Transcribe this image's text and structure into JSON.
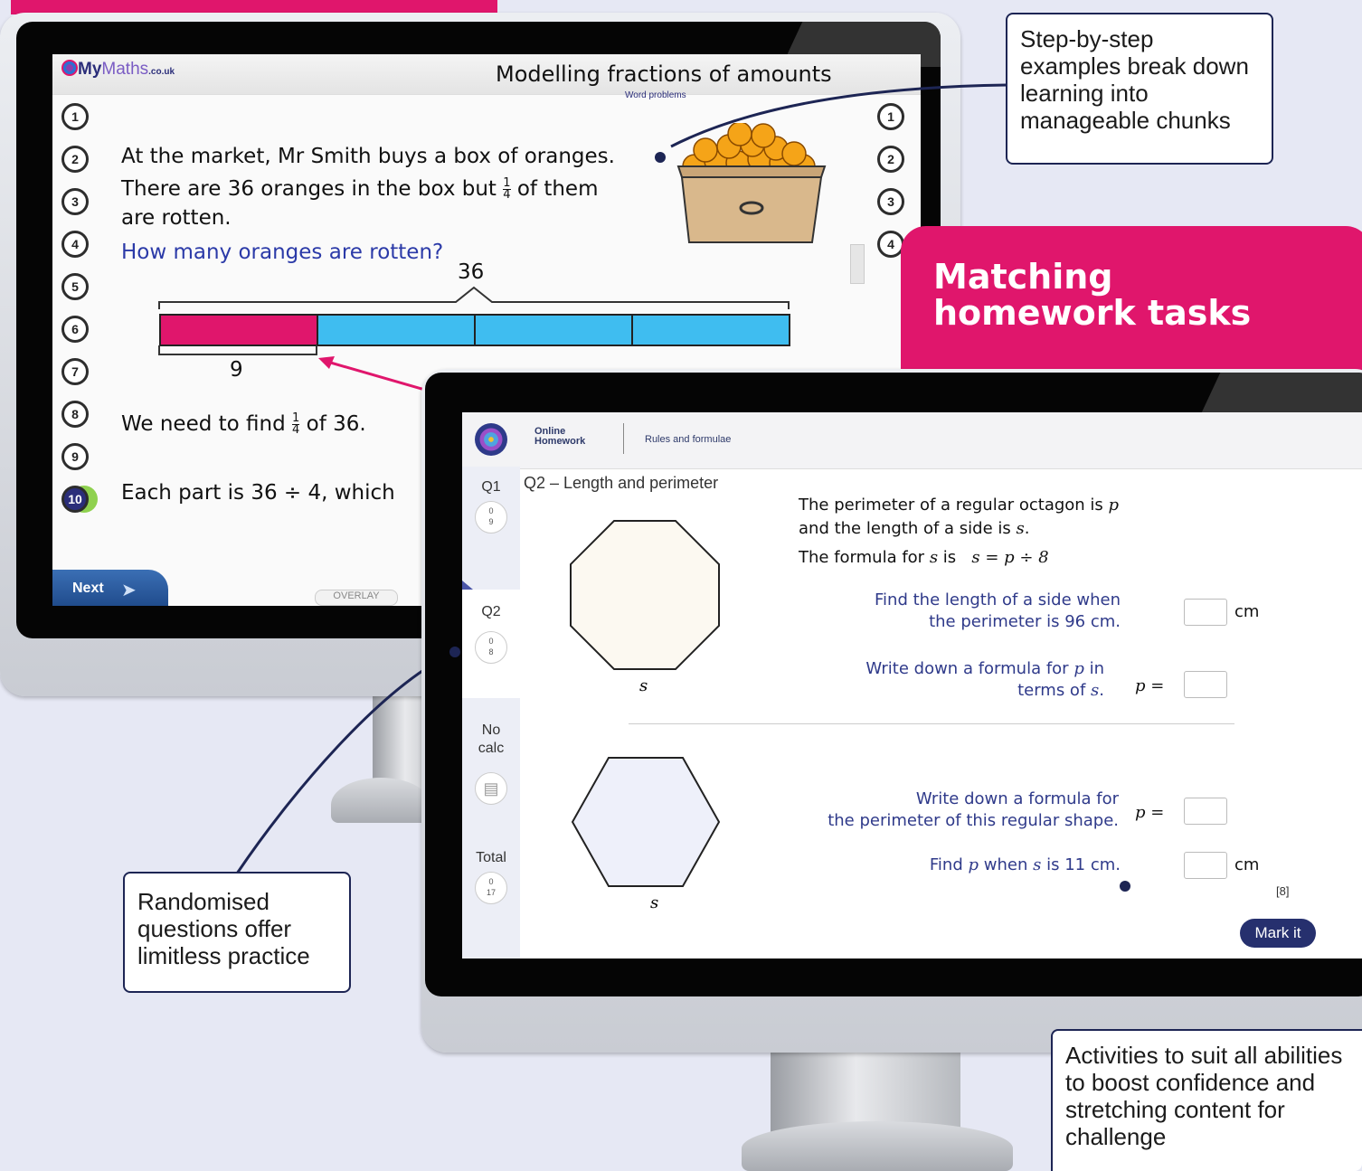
{
  "callouts": {
    "step_by_step": "Step-by-step examples break down learning into manageable chunks",
    "randomised": "Randomised questions offer limitless practice",
    "activities": "Activities to suit all abilities to boost confidence and stretching content for challenge"
  },
  "banner": {
    "matching": "Matching homework tasks"
  },
  "lesson": {
    "logo_my": "My",
    "logo_maths": "Maths",
    "logo_domain": ".co.uk",
    "title": "Modelling fractions of amounts",
    "subtitle": "Word problems",
    "left_steps": [
      "1",
      "2",
      "3",
      "4",
      "5",
      "6",
      "7",
      "8",
      "9",
      "10"
    ],
    "right_steps": [
      "1",
      "2",
      "3",
      "4"
    ],
    "line1": "At the market, Mr Smith buys a box of oranges.",
    "line2_a": "There are 36 oranges in the box but",
    "line2_b": "of them",
    "line3": "are rotten.",
    "frac_num": "1",
    "frac_den": "4",
    "question": "How many oranges are rotten?",
    "bar_total": "36",
    "bar_part": "9",
    "line4_a": "We need to find",
    "line4_b": "of 36.",
    "line5": "Each part is 36 ÷ 4, which",
    "next_label": "Next",
    "overlay_label": "OVERLAY",
    "colors": {
      "rotten": "#e0166c",
      "fresh": "#3fbdf0"
    }
  },
  "homework": {
    "brand": "Online Homework",
    "brand_line1": "Online",
    "brand_line2": "Homework",
    "nav_title": "Rules and formulae",
    "question_title": "Q2 – Length and perimeter",
    "sidebar": [
      {
        "label": "Q1",
        "score_top": "0",
        "score_bottom": "9"
      },
      {
        "label": "Q2",
        "score_top": "0",
        "score_bottom": "8"
      },
      {
        "label": "No calc"
      },
      {
        "label": "Total",
        "score_top": "0",
        "score_bottom": "17"
      }
    ],
    "intro1": "The perimeter of a regular octagon is",
    "intro1_var": "p",
    "intro2": "and the length of a side is",
    "intro2_var": "s",
    "intro3": "The formula for",
    "intro3_var": "s",
    "intro3_is": "is",
    "formula": "s = p ÷ 8",
    "q_a1": "Find the length of a side when",
    "q_a2": "the perimeter is 96 cm.",
    "q_b1": "Write down a formula for",
    "q_b1_var": "p",
    "q_b1_end": "in",
    "q_b2": "terms of",
    "q_b2_var": "s",
    "q_c1": "Write down a formula for",
    "q_c2": "the perimeter of this regular shape.",
    "q_d": "Find",
    "q_d_var": "p",
    "q_d_mid": "when",
    "q_d_var2": "s",
    "q_d_end": "is 11 cm.",
    "unit_cm": "cm",
    "p_eq": "p =",
    "side_label": "s",
    "marks": "[8]",
    "mark_button": "Mark it"
  }
}
